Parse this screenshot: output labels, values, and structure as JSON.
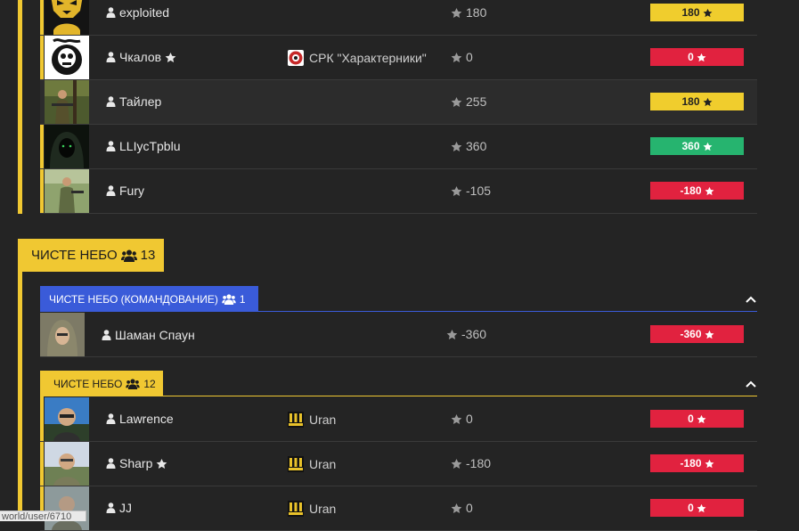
{
  "colors": {
    "accent_yellow": "#f0c832",
    "command_blue": "#3a5bd9",
    "badge_red": "#e1223f",
    "badge_yellow": "#f0cd2d",
    "badge_green": "#26b46f"
  },
  "top_rows": [
    {
      "name": "exploited",
      "starred": false,
      "faction": "",
      "points": "180",
      "badge": "180",
      "badge_color": "yellow",
      "avatar": "yellow-mask"
    },
    {
      "name": "Чкалов",
      "starred": true,
      "faction": "СРК \"Характерники\"",
      "faction_icon": "skull-emblem-icon",
      "points": "0",
      "badge": "0",
      "badge_color": "red",
      "avatar": "skull-emblem"
    },
    {
      "name": "Тайлер",
      "starred": false,
      "faction": "",
      "points": "255",
      "badge": "180",
      "badge_color": "yellow",
      "avatar": "soldier-forest",
      "highlighted": true
    },
    {
      "name": "LLIycTpblu",
      "starred": false,
      "faction": "",
      "points": "360",
      "badge": "360",
      "badge_color": "green",
      "avatar": "hooded-figure"
    },
    {
      "name": "Fury",
      "starred": false,
      "faction": "",
      "points": "-105",
      "badge": "-180",
      "badge_color": "red",
      "avatar": "soldier-field"
    }
  ],
  "group": {
    "name": "ЧИСТЕ НЕБО",
    "count": "13"
  },
  "command_sub": {
    "name": "ЧИСТЕ НЕБО (КОМАНДОВАНИЕ)",
    "count": "1",
    "rows": [
      {
        "name": "Шаман Спаун",
        "starred": false,
        "faction": "",
        "points": "-360",
        "badge": "-360",
        "badge_color": "red",
        "avatar": "hooded-soldier"
      }
    ]
  },
  "main_sub": {
    "name": "ЧИСТЕ НЕБО",
    "count": "12",
    "rows": [
      {
        "name": "Lawrence",
        "starred": false,
        "faction": "Uran",
        "faction_icon": "uran-logo-icon",
        "points": "0",
        "badge": "0",
        "badge_color": "red",
        "avatar": "person-blue"
      },
      {
        "name": "Sharp",
        "starred": true,
        "faction": "Uran",
        "faction_icon": "uran-logo-icon",
        "points": "-180",
        "badge": "-180",
        "badge_color": "red",
        "avatar": "person-outdoor"
      },
      {
        "name": "JJ",
        "starred": false,
        "faction": "Uran",
        "faction_icon": "uran-logo-icon",
        "points": "0",
        "badge": "0",
        "badge_color": "red",
        "avatar": "person-gray"
      }
    ]
  },
  "status_url": "world/user/6710"
}
